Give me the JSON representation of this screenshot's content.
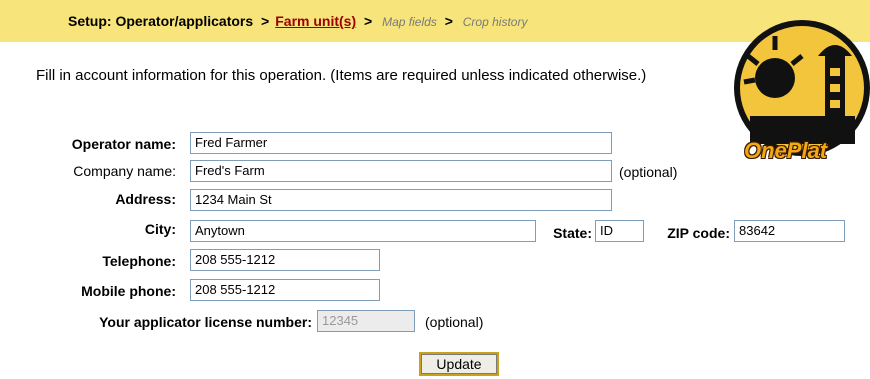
{
  "breadcrumb": {
    "step1": "Setup: Operator/applicators",
    "sep": ">",
    "current": "Farm unit(s)",
    "step3": "Map fields",
    "step4": "Crop history"
  },
  "intro": "Fill in account information for this operation. (Items are required unless indicated otherwise.)",
  "form": {
    "operator_label": "Operator name:",
    "operator_value": "Fred Farmer",
    "company_label": "Company name:",
    "company_value": "Fred's Farm",
    "address_label": "Address:",
    "address_value": "1234 Main St",
    "city_label": "City:",
    "city_value": "Anytown",
    "state_label": "State:",
    "state_value": "ID",
    "zip_label": "ZIP code:",
    "zip_value": "83642",
    "telephone_label": "Telephone:",
    "telephone_value": "208 555-1212",
    "mobile_label": "Mobile phone:",
    "mobile_value": "208 555-1212",
    "license_label": "Your applicator license number:",
    "license_value": "12345",
    "optional": "(optional)"
  },
  "update_button": "Update",
  "logo": {
    "text": "OnePlat",
    "icon": "oneplat-logo-icon"
  },
  "colors": {
    "header_bar": "#f7e47a",
    "current_link": "#9b0000",
    "logo_orange": "#f3a712"
  }
}
